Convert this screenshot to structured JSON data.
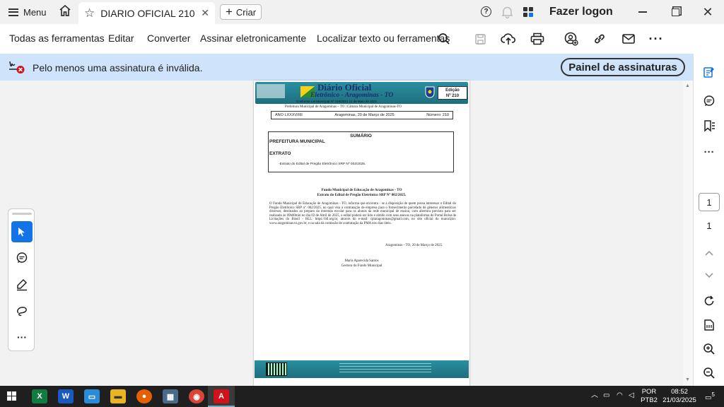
{
  "titlebar": {
    "menu_label": "Menu",
    "tab_title": "DIARIO OFICIAL 210....",
    "create_label": "Criar",
    "login_label": "Fazer logon"
  },
  "toolbar": {
    "all_tools": "Todas as ferramentas",
    "edit": "Editar",
    "convert": "Converter",
    "sign": "Assinar eletronicamente",
    "search_label": "Localizar texto ou ferramentas"
  },
  "signature_bar": {
    "message": "Pelo menos uma assinatura é inválida.",
    "panel_button": "Painel de assinaturas"
  },
  "document": {
    "masthead_title": "Diário Oficial",
    "masthead_subtitle": "Eletrônico - Aragominas - TO",
    "edition_label": "Edição",
    "edition_number": "Nº 210",
    "conformity": "Conforme Lei Municipal Nº 416/2021 11 de Maio de 2021",
    "header_line": "Prefeitura Municipal de Aragominas – TO | Câmara Municipal de Aragominas-TO",
    "ano": "ANO LXXXVIIIII",
    "date_line": "Aragominas, 20 de Março de 2025",
    "numero": "Número: 210",
    "summary_title": "SUMÁRIO",
    "summary_section": "PREFEITURA MUNICIPAL",
    "summary_sub": "EXTRATO",
    "summary_item": "-Extrato do Edital de Pregão Eletrônico SRP Nº 002/2025.",
    "fund_title": "Fundo Municipal de Educação de Aragominas - TO",
    "fund_subtitle": "Extrato do Edital de Pregão Eletrônico SRP Nº 002/2025.",
    "body_text": "O Fundo Municipal de Educação de Aragominas - TO, informa que encontra - se à disposição de quem possa interessar o Edital do Pregão Eletrônico SRP nº. 002/2025, no qual visa a contratação de empresa para o fornecimento parcelado de gêneros alimentícios diversos, destinados ao preparo da merenda escolar para os alunos da rede municipal de ensino, com abertura prevista para ser realizado às 09h00min no dia 02 de Abril de 2025, o edital poderá ser lido e obtido com seus anexos na plataforma do Portal Bolsa de Licitações do Brasil - BLL: https://bll.org.br, através do e-mail: cplaragominas@gmail.com, no site oficial do município: www.aragominas.to.gov.br, e na sala da comissão de contratação da PMA nos dias úteis.",
    "closing_date": "Aragominas - TO, 20 de Março de 2025.",
    "signer_name": "Maria Aparecida Santos",
    "signer_role": "Gestora do Fundo Municipal"
  },
  "page_nav": {
    "current_page": "1",
    "total_pages": "1"
  },
  "taskbar": {
    "lang_top": "POR",
    "lang_bottom": "PTB2",
    "time": "08:52",
    "date": "21/03/2025",
    "notif_count": "5"
  },
  "colors": {
    "accent": "#1473e6",
    "sigbar": "#cfe3fb",
    "masthead": "#1d6e7f",
    "acrobat_red": "#d1121b"
  }
}
